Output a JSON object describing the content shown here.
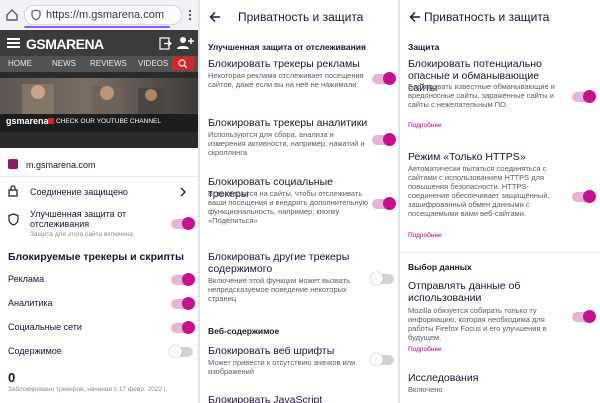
{
  "colors": {
    "accent": "#c5118b",
    "link": "#b5007f",
    "toggle_track_on": "#e7b3d9"
  },
  "browser": {
    "url": "m.gsmarena.com",
    "url_prefix": "https://"
  },
  "site": {
    "logo": "GSMARENA",
    "nav": [
      "HOME",
      "NEWS",
      "REVIEWS",
      "VIDEOS"
    ],
    "banner_logo": "gsmarena",
    "banner_cta": "CHECK OUR YOUTUBE CHANNEL"
  },
  "panel1": {
    "site_name": "m.gsmarena.com",
    "connection": "Соединение защищено",
    "etp_title": "Улучшенная защита от отслеживания",
    "etp_desc": "Защита для этого сайта включена",
    "blocked_header": "Блокируемые трекеры и скрипты",
    "rows": [
      {
        "label": "Реклама",
        "on": true
      },
      {
        "label": "Аналитика",
        "on": true
      },
      {
        "label": "Социальные сети",
        "on": true
      },
      {
        "label": "Содержимое",
        "on": false
      }
    ],
    "count": "0",
    "count_note": "Заблокировано трекеров, начиная с 17 февр. 2022 г."
  },
  "panel2": {
    "title": "Приватность и защита",
    "section1": "Улучшенная защита от отслеживания",
    "items": [
      {
        "title": "Блокировать трекеры рекламы",
        "desc": "Некоторая реклама отслеживает посещения сайтов, даже если вы на неё не нажимали",
        "on": true
      },
      {
        "title": "Блокировать трекеры аналитики",
        "desc": "Используются для сбора, анализа и измерения активности, например, нажатий и скроллинга",
        "on": true
      },
      {
        "title": "Блокировать социальные трекеры",
        "desc": "Встраиваются на сайты, чтобы отслеживать ваши посещения и внедрять дополнительную функциональность, например, кнопку «Поделиться»",
        "on": true
      },
      {
        "title": "Блокировать другие трекеры содержимого",
        "desc": "Включение этой функции может вызвать непредсказуемое поведение некоторых страниц",
        "on": false
      }
    ],
    "section2": "Веб-содержимое",
    "fonts_title": "Блокировать веб шрифты",
    "fonts_desc": "Может привести к отсутствию значков или изображений",
    "fonts_on": false,
    "js_title": "Блокировать JavaScript"
  },
  "panel3": {
    "title": "Приватность и защита",
    "section1": "Защита",
    "safe_title": "Блокировать потенциально опасные и обманывающие сайты",
    "safe_desc": "Блокировать известные обманывающие и вредоносные сайты, заражённые сайты и сайты с нежелательным ПО.",
    "safe_more": "Подробнее",
    "safe_on": true,
    "https_title": "Режим «Только HTTPS»",
    "https_desc": "Автоматически пытаться соединяться с сайтами с использованием HTTPS для повышения безопасности. HTTPS-соединение обеспечивает защищённый, зашифрованный обмен данными с посещаемыми вами веб-сайтами.",
    "https_more": "Подробнее",
    "https_on": true,
    "section2": "Выбор данных",
    "usage_title": "Отправлять данные об использовании",
    "usage_desc": "Mozilla обязуется собирать только ту информацию, которая необходима для работы Firefox Focus и его улучшения в будущем.",
    "usage_more": "Подробнее",
    "usage_on": true,
    "studies_title": "Исследования",
    "studies_desc": "Включено"
  }
}
